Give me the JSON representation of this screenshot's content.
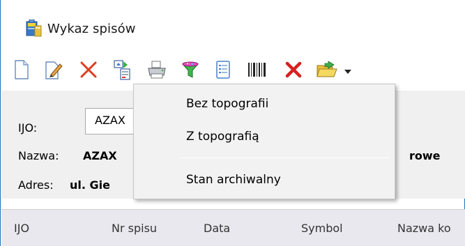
{
  "window": {
    "title": "Wykaz spisów",
    "title_icon": "binder-icon"
  },
  "toolbar": {
    "buttons": [
      {
        "name": "new-document-icon",
        "tooltip": ""
      },
      {
        "name": "edit-icon",
        "tooltip": ""
      },
      {
        "name": "delete-icon",
        "tooltip": ""
      },
      {
        "name": "report-dropdown-icon",
        "tooltip": ""
      },
      {
        "name": "print-icon",
        "tooltip": ""
      },
      {
        "name": "filter-icon",
        "tooltip": ""
      },
      {
        "name": "list-document-icon",
        "tooltip": ""
      },
      {
        "name": "barcode-icon",
        "tooltip": ""
      },
      {
        "name": "cancel-icon",
        "tooltip": ""
      },
      {
        "name": "open-folder-icon",
        "tooltip": ""
      },
      {
        "name": "chevron-down-icon",
        "tooltip": ""
      }
    ]
  },
  "form": {
    "ijo_label": "IJO:",
    "ijo_value": "AZAX",
    "nazwa_label": "Nazwa:",
    "nazwa_value": "AZAX",
    "nazwa_tail": "rowe",
    "adres_label": "Adres:",
    "adres_value": "ul. Gie"
  },
  "grid": {
    "columns": [
      "IJO",
      "Nr spisu",
      "Data",
      "Symbol",
      "Nazwa ko"
    ]
  },
  "menu": {
    "items": [
      {
        "label": "Bez topografii"
      },
      {
        "label": "Z topografią"
      },
      {
        "label": "Stan archiwalny"
      }
    ]
  },
  "colors": {
    "window_border": "#1e74b8",
    "grid_header_bg": "#e8e8ee",
    "menu_bg": "#f2f2f2",
    "delete_red": "#e03c1e"
  }
}
